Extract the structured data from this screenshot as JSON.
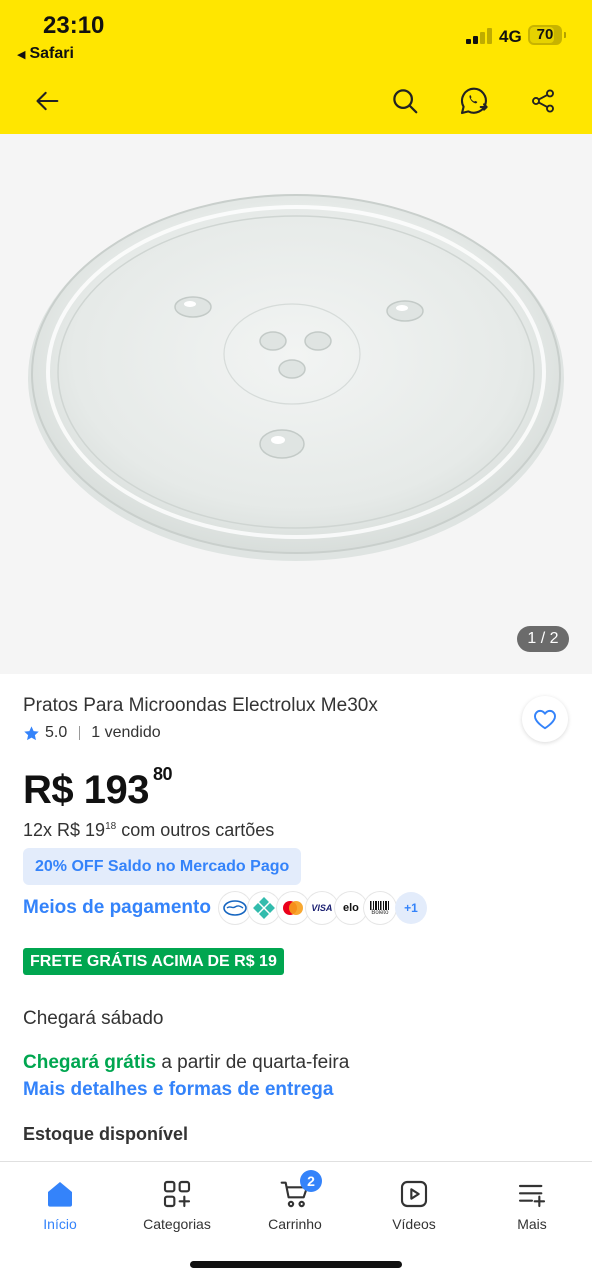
{
  "status_bar": {
    "time": "23:10",
    "back_app": "Safari",
    "network": "4G",
    "battery": "70",
    "battery_level": 0.7
  },
  "header": {
    "background_color": "#ffe600",
    "back_icon": "arrow-left-icon",
    "search_icon": "search-icon",
    "whatsapp_icon": "whatsapp-share-icon",
    "share_icon": "share-icon"
  },
  "gallery": {
    "counter": "1 / 2",
    "image_icon": "glass-turntable-plate-image"
  },
  "product": {
    "title": "Pratos Para Microondas Electrolux Me30x",
    "rating": "5.0",
    "sold": "1 vendido",
    "price_main": "R$ 193",
    "price_cents": "80",
    "installment_prefix": "12x R$ 19",
    "installment_cents": "18",
    "installment_suffix": " com outros cartões",
    "promo": "20% OFF Saldo no Mercado Pago",
    "payment_label": "Meios de pagamento",
    "payment_methods": [
      "mercadopago-icon",
      "pix-icon",
      "mastercard-icon",
      "visa-icon",
      "elo-icon",
      "boleto-icon"
    ],
    "visa_text": "VISA",
    "elo_text": "elo",
    "boleto_text": "Boleto",
    "payment_more": "+1",
    "shipping_badge": "FRETE GRÁTIS ACIMA DE R$ 19",
    "arrival": "Chegará sábado",
    "free_arrival_highlight": "Chegará grátis",
    "free_arrival_rest": " a partir de quarta-feira",
    "delivery_link": "Mais detalhes e formas de entrega",
    "stock": "Estoque disponível"
  },
  "colors": {
    "brand_yellow": "#ffe600",
    "link_blue": "#3483fa",
    "success_green": "#00a650"
  },
  "tab_bar": {
    "tabs": [
      {
        "label": "Início",
        "icon": "home-icon",
        "active": true
      },
      {
        "label": "Categorias",
        "icon": "categories-icon"
      },
      {
        "label": "Carrinho",
        "icon": "cart-icon",
        "badge": "2"
      },
      {
        "label": "Vídeos",
        "icon": "video-play-icon"
      },
      {
        "label": "Mais",
        "icon": "menu-plus-icon"
      }
    ]
  }
}
